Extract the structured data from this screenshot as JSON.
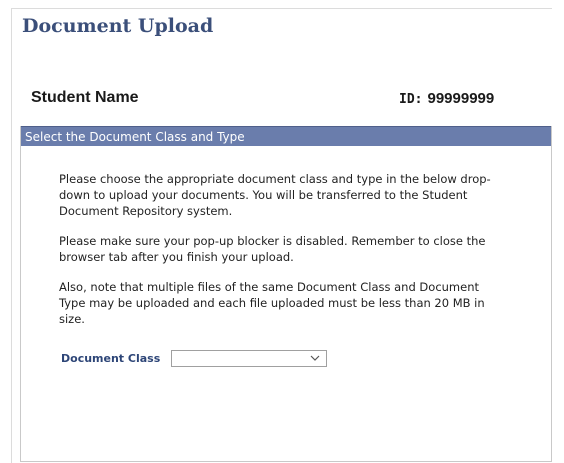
{
  "page": {
    "title": "Document Upload"
  },
  "student": {
    "name_label": "Student Name",
    "id_label": "ID:",
    "id_value": "99999999"
  },
  "section": {
    "header": "Select the Document Class and Type",
    "paragraphs": [
      "Please choose the appropriate document class and type in the below drop-down to upload your documents. You will be transferred to the Student Document Repository system.",
      "Please make sure your pop-up blocker is disabled. Remember to close the browser tab after you finish your upload.",
      "Also, note that multiple files of the same Document Class and Document Type may be uploaded and each file uploaded must be less than 20 MB in size."
    ],
    "document_class": {
      "label": "Document Class",
      "selected_value": ""
    }
  },
  "colors": {
    "title": "#3b4f7a",
    "section_header_bg": "#6a7dac",
    "field_label": "#2d4577"
  },
  "icons": {
    "select_arrow": "chevron-down-icon"
  }
}
